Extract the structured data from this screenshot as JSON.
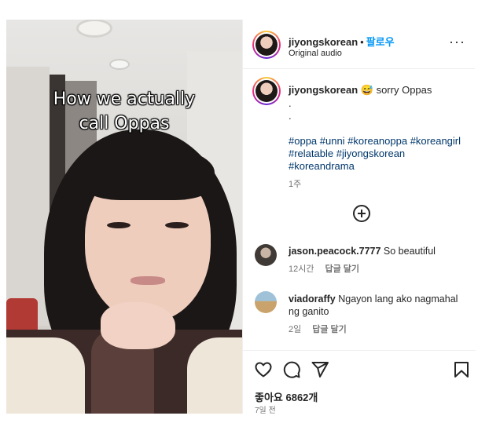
{
  "media": {
    "overlay_line1": "How we actually",
    "overlay_line2": "call Oppas"
  },
  "header": {
    "username": "jiyongskorean",
    "dot": "•",
    "follow_label": "팔로우",
    "audio": "Original audio",
    "more_label": "···",
    "more_icon": "more-horizontal-icon"
  },
  "caption": {
    "username": "jiyongskorean",
    "emoji": "😅",
    "text": "sorry Oppas",
    "dot1": ".",
    "dot2": ".",
    "hashtags": "#oppa #unni #koreanoppa #koreangirl #relatable #jiyongskorean #koreandrama",
    "time": "1주"
  },
  "load_more_icon": "plus-circle-icon",
  "comments": [
    {
      "username": "jason.peacock.7777",
      "text": "So beautiful",
      "time": "12시간",
      "reply": "답글 달기"
    },
    {
      "username": "viadoraffy",
      "text": "Ngayon lang ako nagmahal ng ganito",
      "time": "2일",
      "reply": "답글 달기"
    }
  ],
  "actions": {
    "like_icon": "heart-icon",
    "comment_icon": "comment-icon",
    "share_icon": "send-icon",
    "save_icon": "bookmark-icon",
    "likes_text": "좋아요 6862개",
    "posted_ago": "7일 전"
  },
  "colors": {
    "link": "#00376b",
    "follow": "#0095f6",
    "muted": "#737373"
  }
}
